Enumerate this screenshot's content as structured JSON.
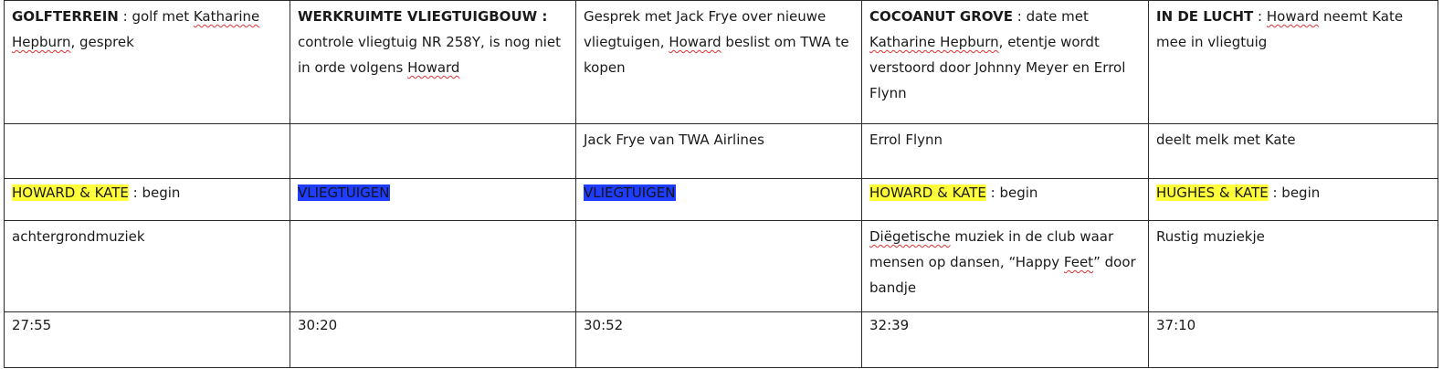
{
  "cells": {
    "c1": {
      "location": "GOLFTERREIN",
      "sep": " : ",
      "desc_a": "golf met ",
      "desc_sq1": "Katharine",
      "desc_b": " ",
      "desc_sq2": "Hepburn",
      "desc_c": ",  gesprek",
      "character": "",
      "theme": "HOWARD & KATE",
      "theme_suffix": " : begin",
      "music": "achtergrondmuziek",
      "time": "27:55"
    },
    "c2": {
      "location": "WERKRUIMTE VLIEGTUIGBOUW :",
      "desc_a": " controle vliegtuig NR 258Y, is nog niet in orde volgens ",
      "desc_sq1": "Howard",
      "character": "",
      "theme": "VLIEGTUIGEN",
      "music": "",
      "time": "30:20"
    },
    "c3": {
      "desc_a": "Gesprek met Jack Frye over nieuwe vliegtuigen, ",
      "desc_sq1": "Howard",
      "desc_b": " beslist om TWA te kopen",
      "character": "Jack Frye van TWA Airlines",
      "theme": "VLIEGTUIGEN",
      "music": "",
      "time": "30:52"
    },
    "c4": {
      "location": "COCOANUT GROVE",
      "sep": " : ",
      "desc_a": "date met ",
      "desc_sq1": "Katharine Hepburn",
      "desc_b": ", etentje wordt verstoord door Johnny  Meyer en Errol Flynn",
      "character": "Errol Flynn",
      "theme": "HOWARD & KATE",
      "theme_suffix": " : begin",
      "music_sq1": "Diëgetische",
      "music_a": " muziek in de club waar mensen op dansen, “Happy ",
      "music_sq2": "Feet",
      "music_b": "” door bandje",
      "time": "32:39"
    },
    "c5": {
      "location": "IN DE LUCHT",
      "sep": " : ",
      "desc_sq1": "Howard",
      "desc_a": " neemt Kate mee in vliegtuig",
      "character": "deelt melk met Kate",
      "theme": "HUGHES & KATE",
      "theme_suffix": " : begin",
      "music": "Rustig muziekje",
      "time": "37:10"
    }
  }
}
